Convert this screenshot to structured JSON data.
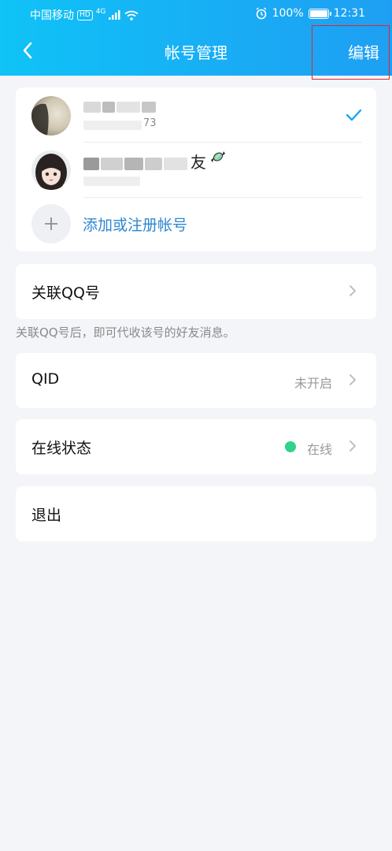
{
  "status_bar": {
    "carrier": "中国移动",
    "hd": "HD",
    "network": "4G",
    "battery": "100%",
    "time": "12:31"
  },
  "header": {
    "title": "帐号管理",
    "edit_label": "编辑"
  },
  "accounts": [
    {
      "sub": "73",
      "selected": true
    },
    {
      "name_suffix": "友"
    }
  ],
  "add_account": {
    "label": "添加或注册帐号"
  },
  "link_qq": {
    "label": "关联QQ号",
    "hint": "关联QQ号后，即可代收该号的好友消息。"
  },
  "qid": {
    "label": "QID",
    "value": "未开启"
  },
  "online_status": {
    "label": "在线状态",
    "value": "在线"
  },
  "logout": {
    "label": "退出"
  },
  "colors": {
    "header_gradient_start": "#0fc3f6",
    "header_gradient_end": "#1e9ff3",
    "link": "#2d87d0",
    "online": "#2fd38a",
    "annotation": "#e4252b"
  }
}
